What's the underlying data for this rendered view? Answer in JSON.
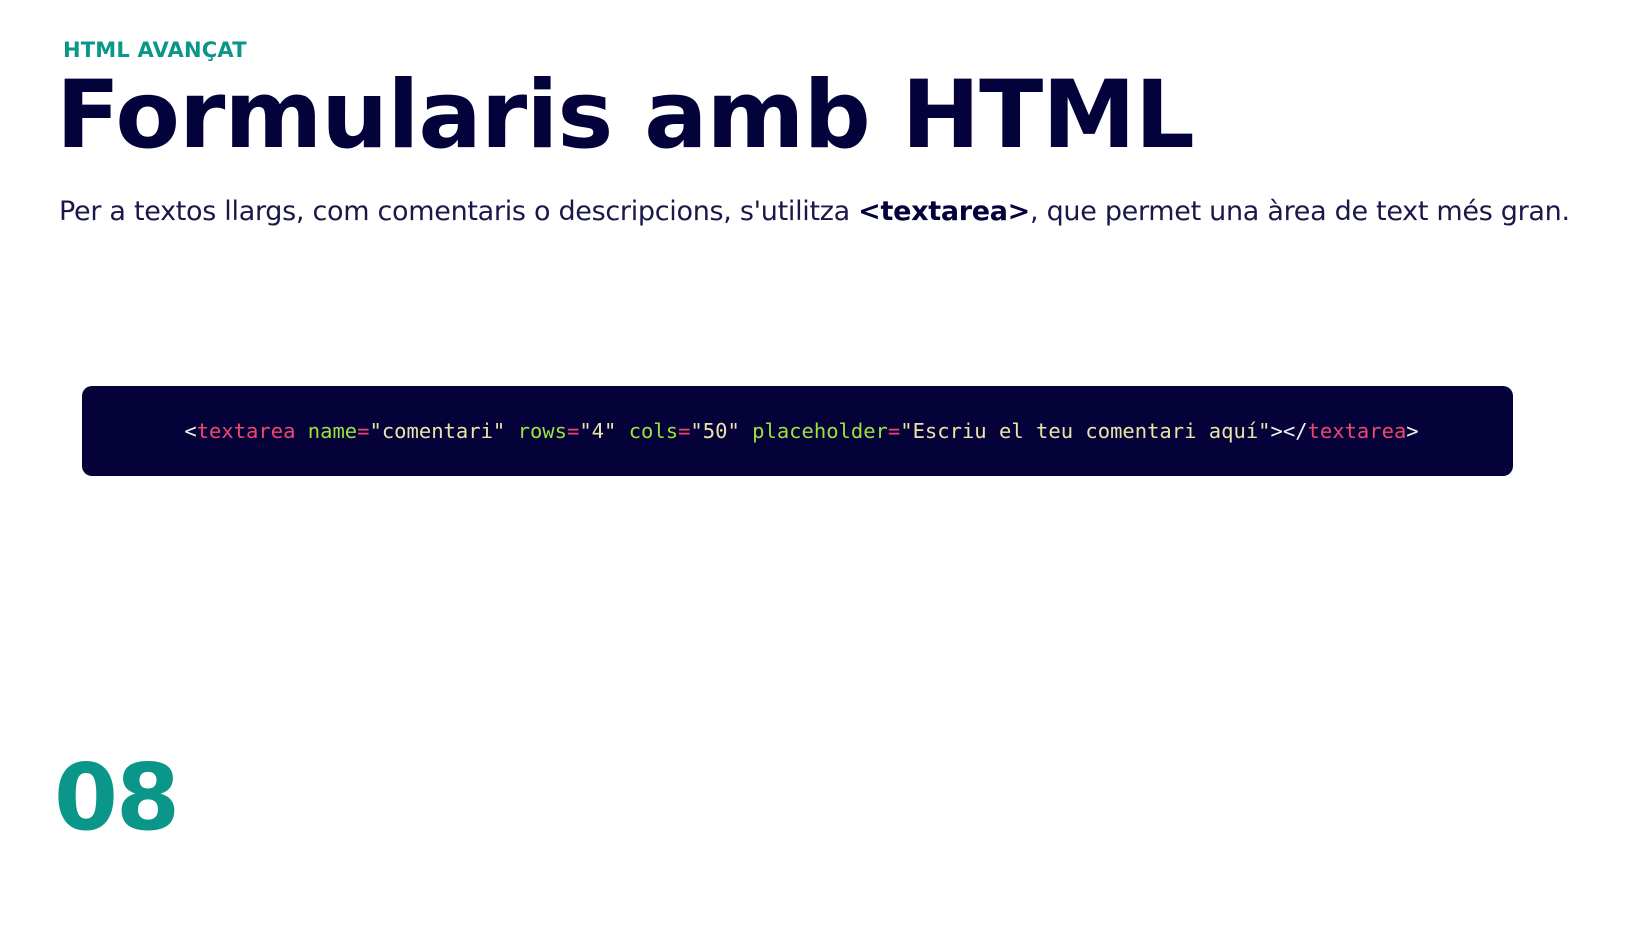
{
  "colors": {
    "accent": "#0a9688",
    "title": "#04023a",
    "code_bg": "#05023a",
    "code_tag": "#f0466e",
    "code_attr": "#9be23b",
    "code_string": "#ece3a6"
  },
  "header": {
    "kicker": "HTML AVANÇAT",
    "title": "Formularis amb HTML"
  },
  "intro": {
    "before": "Per a textos llargs, com comentaris o descripcions, s'utilitza ",
    "emphasis": "<textarea>",
    "after": ", que permet una àrea de text més gran."
  },
  "code": {
    "tokens": [
      {
        "type": "punct",
        "text": "<"
      },
      {
        "type": "tag",
        "text": "textarea"
      },
      {
        "type": "punct",
        "text": " "
      },
      {
        "type": "attr",
        "text": "name"
      },
      {
        "type": "eq",
        "text": "="
      },
      {
        "type": "str",
        "text": "\"comentari\""
      },
      {
        "type": "punct",
        "text": " "
      },
      {
        "type": "attr",
        "text": "rows"
      },
      {
        "type": "eq",
        "text": "="
      },
      {
        "type": "str",
        "text": "\"4\""
      },
      {
        "type": "punct",
        "text": " "
      },
      {
        "type": "attr",
        "text": "cols"
      },
      {
        "type": "eq",
        "text": "="
      },
      {
        "type": "str",
        "text": "\"50\""
      },
      {
        "type": "punct",
        "text": " "
      },
      {
        "type": "attr",
        "text": "placeholder"
      },
      {
        "type": "eq",
        "text": "="
      },
      {
        "type": "str",
        "text": "\"Escriu el teu comentari aquí\""
      },
      {
        "type": "punct",
        "text": "></"
      },
      {
        "type": "tag",
        "text": "textarea"
      },
      {
        "type": "punct",
        "text": ">"
      }
    ]
  },
  "footer": {
    "page_number": "08"
  }
}
